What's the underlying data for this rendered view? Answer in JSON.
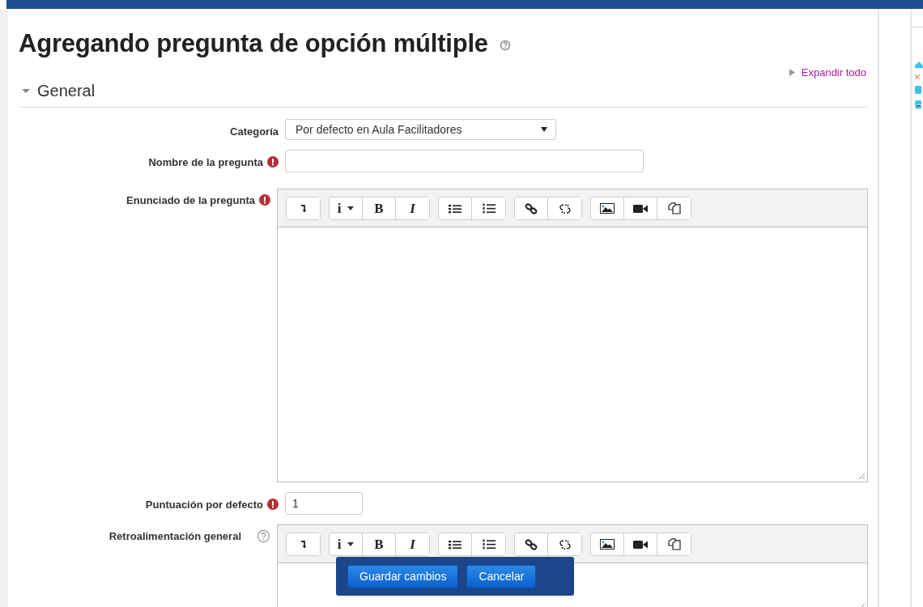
{
  "heading": {
    "title": "Agregando pregunta de opción múltiple"
  },
  "expand_all": "Expandir todo",
  "section": {
    "title": "General",
    "expanded": true
  },
  "fields": [
    {
      "kind": "select",
      "label": "Categoría",
      "required": false,
      "help": false,
      "value": "Por defecto en Aula Facilitadores"
    },
    {
      "kind": "text",
      "label": "Nombre de la pregunta",
      "required": true,
      "help": false
    },
    {
      "kind": "editor",
      "label": "Enunciado de la pregunta",
      "required": true,
      "help": false,
      "toolbar": [
        [
          {
            "kind": "indent"
          }
        ],
        [
          {
            "kind": "text",
            "label": "i",
            "caret": true,
            "italic": false
          },
          {
            "kind": "text",
            "label": "B",
            "caret": false,
            "italic": false
          },
          {
            "kind": "text",
            "label": "I",
            "caret": false,
            "italic": true
          }
        ],
        [
          {
            "kind": "ul"
          },
          {
            "kind": "ol"
          }
        ],
        [
          {
            "kind": "link"
          },
          {
            "kind": "unlink"
          }
        ],
        [
          {
            "kind": "image"
          },
          {
            "kind": "video"
          },
          {
            "kind": "copy"
          }
        ]
      ]
    },
    {
      "kind": "number",
      "label": "Puntuación por defecto",
      "required": true,
      "help": false,
      "value": "1"
    },
    {
      "kind": "editor",
      "label": "Retroalimentación general",
      "required": false,
      "help": true,
      "toolbar": [
        [
          {
            "kind": "indent"
          }
        ],
        [
          {
            "kind": "text",
            "label": "i",
            "caret": true,
            "italic": false
          },
          {
            "kind": "text",
            "label": "B",
            "caret": false,
            "italic": false
          },
          {
            "kind": "text",
            "label": "I",
            "caret": false,
            "italic": true
          }
        ],
        [
          {
            "kind": "ul"
          },
          {
            "kind": "ol"
          }
        ],
        [
          {
            "kind": "link"
          },
          {
            "kind": "unlink"
          }
        ],
        [
          {
            "kind": "image"
          },
          {
            "kind": "video"
          },
          {
            "kind": "copy"
          }
        ]
      ]
    }
  ],
  "action_bar": {
    "buttons": [
      "Guardar cambios",
      "Cancelar"
    ]
  }
}
